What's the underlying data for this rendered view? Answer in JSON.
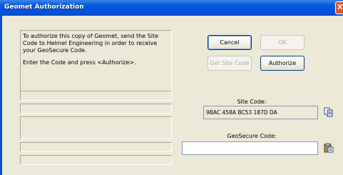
{
  "window": {
    "title": "Geomet Authorization",
    "close_glyph": "X"
  },
  "info": {
    "paragraph1": "To authorize this copy of Geomet, send the Site Code to Helmel Engineering in order to receive your GeoSecure Code.",
    "paragraph2": "Enter the Code and press <Authorize>."
  },
  "buttons": {
    "cancel": "Cancel",
    "ok": "OK",
    "get_site_code": "Get Site Code",
    "authorize": "Authorize"
  },
  "site_code": {
    "label": "Site Code:",
    "value": "9BAC 458A BC53 187D DA"
  },
  "geosecure_code": {
    "label": "GeoSecure Code:",
    "value": ""
  },
  "icons": {
    "copy": "copy-icon",
    "paste": "paste-icon"
  }
}
